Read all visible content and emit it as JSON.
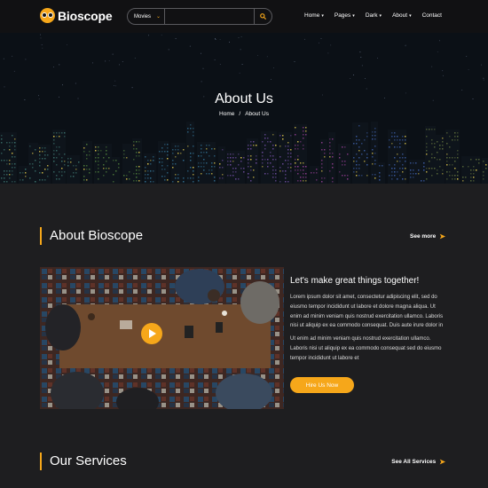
{
  "brand": {
    "name": "Bioscope"
  },
  "search": {
    "category": "Movies",
    "placeholder": ""
  },
  "nav": {
    "items": [
      {
        "label": "Home",
        "dropdown": true
      },
      {
        "label": "Pages",
        "dropdown": true
      },
      {
        "label": "Dark",
        "dropdown": true
      },
      {
        "label": "About",
        "dropdown": true
      },
      {
        "label": "Contact",
        "dropdown": false
      }
    ]
  },
  "hero": {
    "title": "About Us",
    "breadcrumb": {
      "home": "Home",
      "separator": "/",
      "current": "About Us"
    }
  },
  "about": {
    "section_title": "About Bioscope",
    "see_more": "See more",
    "heading": "Let's make great things together!",
    "paragraph1": "Lorem ipsum dolor sit amet, consectetur adipiscing elit, sed do eiusmo tempor incididunt ut labore et dolore magna aliqua. Ut enim ad minim veniam quis nostrud exercitation ullamco. Laboris nisi ut aliquip ex ea commodo consequat. Duis aute irure dolor in",
    "paragraph2": "Ut enim ad minim veniam quis nostrud exercitation ullamco. Laboris nisi ut aliquip ex ea commodo consequat sed do eiusmo tempor incididunt ut labore et",
    "cta": "Hire Us Now"
  },
  "services": {
    "section_title": "Our Services",
    "see_all": "See All Services"
  },
  "colors": {
    "accent": "#f6a71a",
    "header_bg": "#111113",
    "page_bg": "#1e1e20"
  },
  "icons": [
    "logo-owl-icon",
    "chevron-down-icon",
    "search-icon",
    "arrow-right-icon",
    "play-icon"
  ]
}
